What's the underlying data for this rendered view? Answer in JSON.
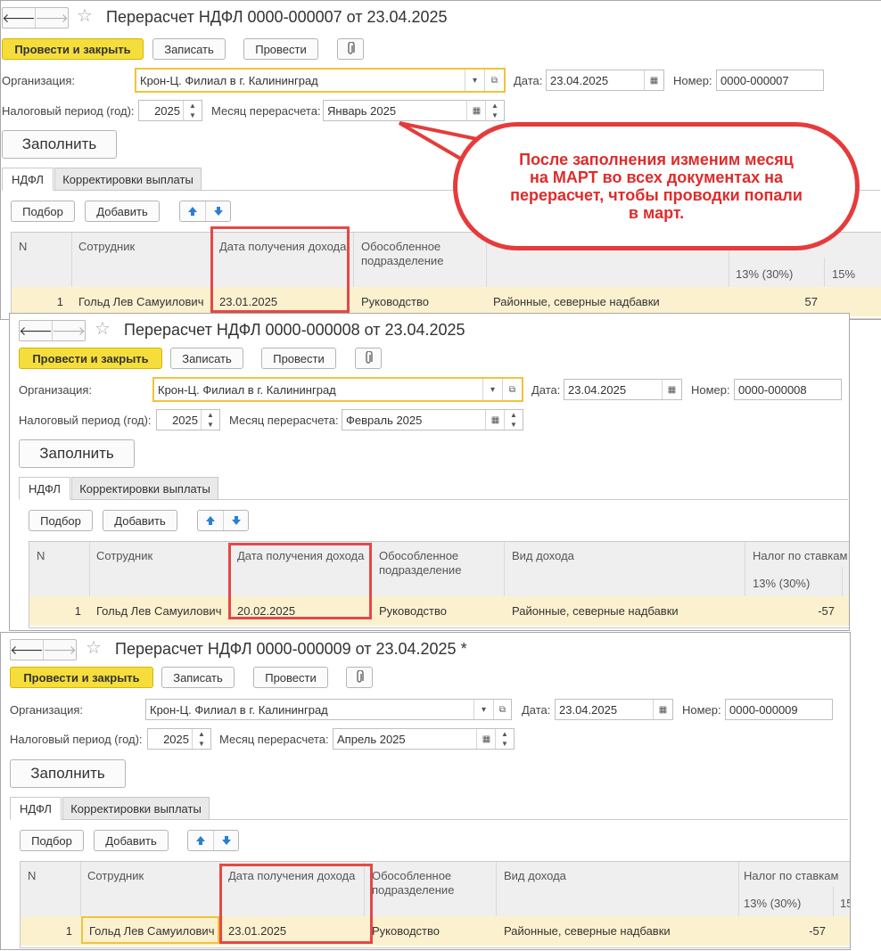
{
  "docs": [
    {
      "title": "Перерасчет НДФЛ 0000-000007 от 23.04.2025",
      "buttons": {
        "post_close": "Провести и закрыть",
        "write": "Записать",
        "post": "Провести"
      },
      "org_label": "Организация:",
      "org_value": "Крон-Ц. Филиал в г. Калининград",
      "date_label": "Дата:",
      "date_value": "23.04.2025",
      "number_label": "Номер:",
      "number_value": "0000-000007",
      "period_label": "Налоговый период (год):",
      "period_value": "2025",
      "month_label": "Месяц перерасчета:",
      "month_value": "Январь 2025",
      "fill_button": "Заполнить",
      "tabs": [
        "НДФЛ",
        "Корректировки выплаты"
      ],
      "table_buttons": {
        "select": "Подбор",
        "add": "Добавить"
      },
      "columns": {
        "n": "N",
        "employee": "Сотрудник",
        "income_date": "Дата получения дохода",
        "division": "Обособленное подразделение",
        "income_type": "",
        "tax_rates": "",
        "rate13": "13% (30%)",
        "rate15": "15%"
      },
      "row": {
        "n": "1",
        "employee": "Гольд Лев Самуилович",
        "income_date": "23.01.2025",
        "division": "Руководство",
        "income_type": "Районные, северные надбавки",
        "amount": "57"
      }
    },
    {
      "title": "Перерасчет НДФЛ 0000-000008 от 23.04.2025",
      "buttons": {
        "post_close": "Провести и закрыть",
        "write": "Записать",
        "post": "Провести"
      },
      "org_label": "Организация:",
      "org_value": "Крон-Ц. Филиал в г. Калининград",
      "date_label": "Дата:",
      "date_value": "23.04.2025",
      "number_label": "Номер:",
      "number_value": "0000-000008",
      "period_label": "Налоговый период (год):",
      "period_value": "2025",
      "month_label": "Месяц перерасчета:",
      "month_value": "Февраль 2025",
      "fill_button": "Заполнить",
      "tabs": [
        "НДФЛ",
        "Корректировки выплаты"
      ],
      "table_buttons": {
        "select": "Подбор",
        "add": "Добавить"
      },
      "columns": {
        "n": "N",
        "employee": "Сотрудник",
        "income_date": "Дата получения дохода",
        "division": "Обособленное подразделение",
        "income_type": "Вид дохода",
        "tax_rates": "Налог по ставкам",
        "rate13": "13% (30%)",
        "rate15": ""
      },
      "row": {
        "n": "1",
        "employee": "Гольд Лев Самуилович",
        "income_date": "20.02.2025",
        "division": "Руководство",
        "income_type": "Районные, северные надбавки",
        "amount": "-57"
      }
    },
    {
      "title": "Перерасчет НДФЛ 0000-000009 от 23.04.2025 *",
      "buttons": {
        "post_close": "Провести и закрыть",
        "write": "Записать",
        "post": "Провести"
      },
      "org_label": "Организация:",
      "org_value": "Крон-Ц. Филиал в г. Калининград",
      "date_label": "Дата:",
      "date_value": "23.04.2025",
      "number_label": "Номер:",
      "number_value": "0000-000009",
      "period_label": "Налоговый период (год):",
      "period_value": "2025",
      "month_label": "Месяц перерасчета:",
      "month_value": "Апрель 2025",
      "fill_button": "Заполнить",
      "tabs": [
        "НДФЛ",
        "Корректировки выплаты"
      ],
      "table_buttons": {
        "select": "Подбор",
        "add": "Добавить"
      },
      "columns": {
        "n": "N",
        "employee": "Сотрудник",
        "income_date": "Дата получения дохода",
        "division": "Обособленное подразделение",
        "income_type": "Вид дохода",
        "tax_rates": "Налог по ставкам",
        "rate13": "13% (30%)",
        "rate15": "15"
      },
      "row": {
        "n": "1",
        "employee": "Гольд Лев Самуилович",
        "income_date": "23.01.2025",
        "division": "Руководство",
        "income_type": "Районные, северные надбавки",
        "amount": "-57"
      }
    }
  ],
  "callout": "После заполнения изменим месяц на МАРТ во всех документах на перерасчет, чтобы проводки попали в март.",
  "colors": {
    "primary_button": "#f5de3c",
    "highlight_row": "#fcf1cf",
    "annotation_red": "#e64747"
  },
  "icons": [
    "back-arrow-icon",
    "forward-arrow-icon",
    "star-icon",
    "paperclip-icon",
    "dropdown-icon",
    "open-icon",
    "calendar-icon",
    "spin-icon",
    "arrow-up-icon",
    "arrow-down-icon"
  ]
}
